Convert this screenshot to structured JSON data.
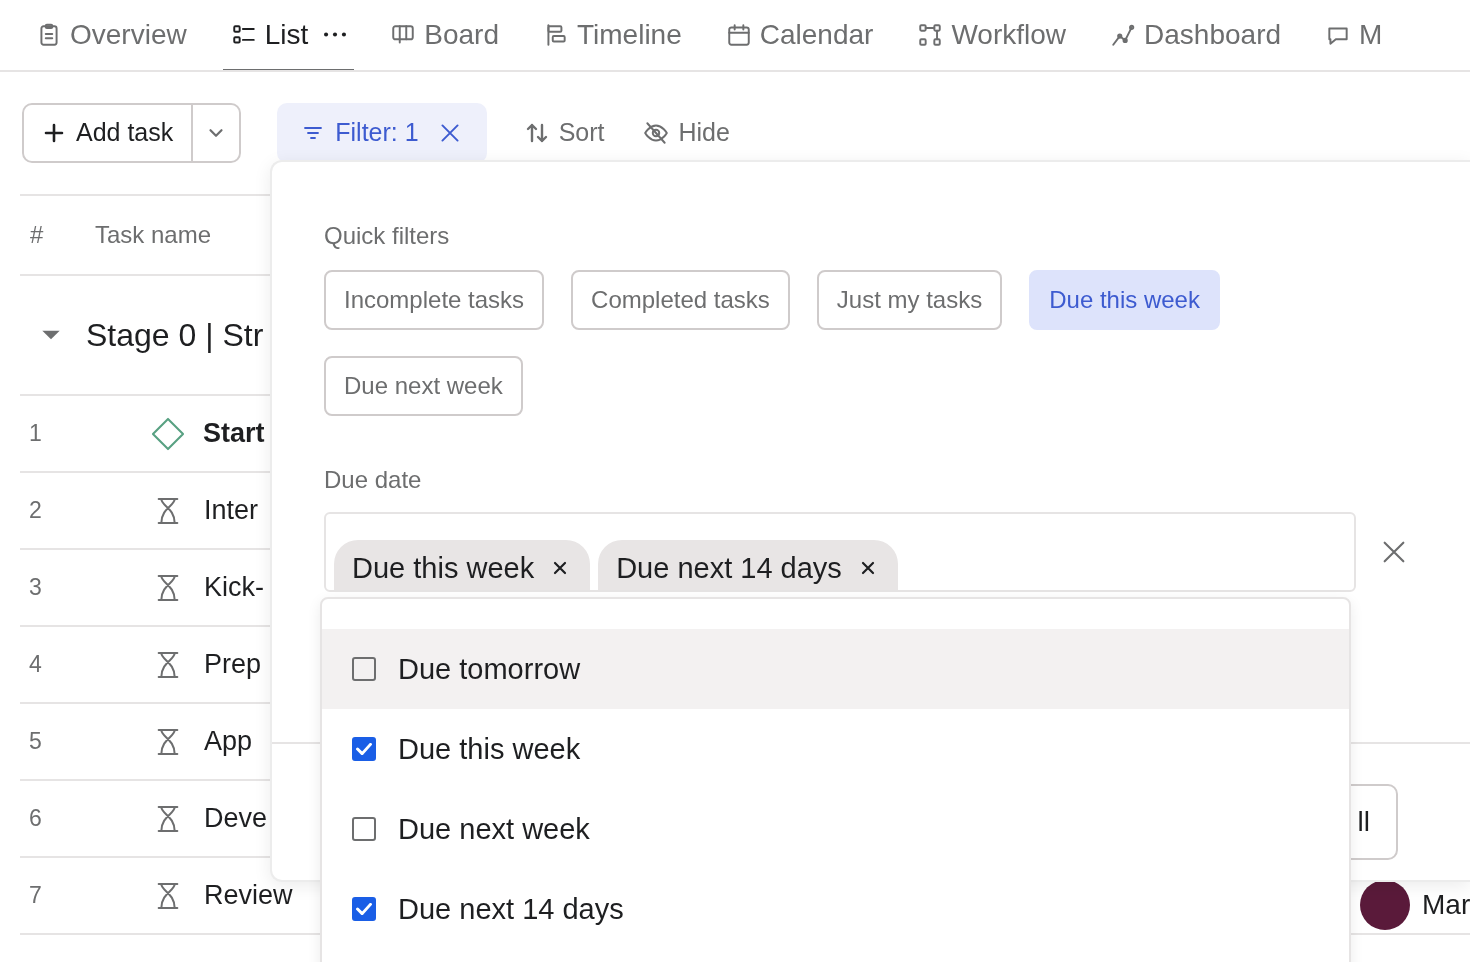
{
  "tabs": [
    {
      "label": "Overview",
      "selected": false
    },
    {
      "label": "List",
      "selected": true
    },
    {
      "label": "Board",
      "selected": false
    },
    {
      "label": "Timeline",
      "selected": false
    },
    {
      "label": "Calendar",
      "selected": false
    },
    {
      "label": "Workflow",
      "selected": false
    },
    {
      "label": "Dashboard",
      "selected": false
    },
    {
      "label": "M",
      "selected": false
    }
  ],
  "toolbar": {
    "add_task": "Add task",
    "filter": "Filter: 1",
    "filter_active": true,
    "sort": "Sort",
    "hide": "Hide"
  },
  "table": {
    "columns": [
      "#",
      "Task name"
    ],
    "group": "Stage 0 | Str",
    "rows": [
      {
        "number": "1",
        "name": "Start",
        "kind": "milestone"
      },
      {
        "number": "2",
        "name": "Inter",
        "kind": "task"
      },
      {
        "number": "3",
        "name": "Kick-",
        "kind": "task"
      },
      {
        "number": "4",
        "name": "Prep",
        "kind": "task"
      },
      {
        "number": "5",
        "name": "App",
        "kind": "task"
      },
      {
        "number": "6",
        "name": "Deve",
        "kind": "task"
      },
      {
        "number": "7",
        "name": "Review",
        "kind": "task",
        "assignee": "Mar"
      }
    ]
  },
  "filter_panel": {
    "quick_filters_label": "Quick filters",
    "quick_filters": [
      {
        "label": "Incomplete tasks",
        "selected": false
      },
      {
        "label": "Completed tasks",
        "selected": false
      },
      {
        "label": "Just my tasks",
        "selected": false
      },
      {
        "label": "Due this week",
        "selected": true
      },
      {
        "label": "Due next week",
        "selected": false
      }
    ],
    "due_date_label": "Due date",
    "due_date_tokens": [
      "Due this week",
      "Due next 14 days"
    ],
    "footer_button": "ll",
    "options": [
      {
        "label": "Due tomorrow",
        "checked": false,
        "highlighted": true
      },
      {
        "label": "Due this week",
        "checked": true,
        "highlighted": false
      },
      {
        "label": "Due next week",
        "checked": false,
        "highlighted": false
      },
      {
        "label": "Due next 14 days",
        "checked": true,
        "highlighted": false
      }
    ]
  }
}
